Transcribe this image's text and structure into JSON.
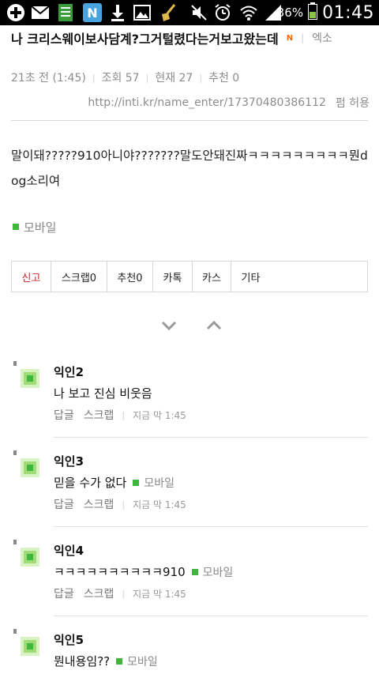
{
  "status_bar": {
    "battery_percent": "36%",
    "time": "01:45",
    "icons": [
      "plus-icon",
      "mail-icon",
      "sheets-icon",
      "n-app-icon",
      "download-icon",
      "image-icon",
      "broom-icon",
      "mute-icon",
      "alarm-icon",
      "wifi-icon",
      "signal-icon",
      "battery-icon"
    ]
  },
  "post": {
    "title": "나 크리스웨이보사담계?그거털렸다는거보고왔는데",
    "n_badge": "N",
    "author": "엑소",
    "time_ago": "21초 전 (1:45)",
    "views": "조회 57",
    "current": "현재 27",
    "recommend": "추천 0",
    "url": "http://inti.kr/name_enter/17370480386112",
    "permission": "펌 허용",
    "body": "말이돼?????910아니야???????말도안돼진짜ㅋㅋㅋㅋㅋㅋㅋㅋㅋ뭔dog소리여",
    "mobile_label": "모바일"
  },
  "actions": {
    "report": "신고",
    "scrap": "스크랩0",
    "recommend": "추천0",
    "katalk": "카톡",
    "kas": "카스",
    "etc": "기타"
  },
  "comments": [
    {
      "name": "익인2",
      "text": "나 보고 진심 비웃음",
      "mobile": "",
      "reply": "답글",
      "scrap": "스크랩",
      "time": "지금 막 1:45"
    },
    {
      "name": "익인3",
      "text": "믿을 수가 없다",
      "mobile": "모바일",
      "reply": "답글",
      "scrap": "스크랩",
      "time": "지금 막 1:45"
    },
    {
      "name": "익인4",
      "text": "ㅋㅋㅋㅋㅋㅋㅋㅋㅋㅋ910",
      "mobile": "모바일",
      "reply": "답글",
      "scrap": "스크랩",
      "time": "지금 막 1:45"
    },
    {
      "name": "익인5",
      "text": "뭔내용임??",
      "mobile": "모바일",
      "reply": "",
      "scrap": "",
      "time": ""
    }
  ],
  "colors": {
    "accent_red": "#c62828",
    "green_dot": "#3fb63c",
    "n_badge": "#ff6600"
  }
}
